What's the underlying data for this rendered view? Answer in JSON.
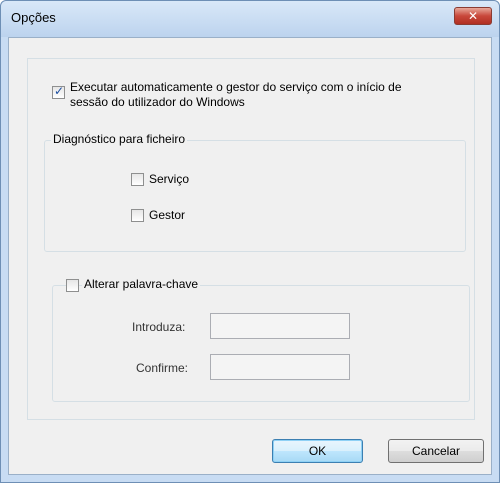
{
  "window": {
    "title": "Opções"
  },
  "options": {
    "auto_start": {
      "label_line1": "Executar automaticamente o gestor do serviço com o início de",
      "label_line2": "sessão do utilizador do Windows",
      "checked": true
    }
  },
  "diagnostics": {
    "legend": "Diagnóstico para ficheiro",
    "service_label": "Serviço",
    "manager_label": "Gestor"
  },
  "password": {
    "legend": "Alterar palavra-chave",
    "enter_label": "Introduza:",
    "confirm_label": "Confirme:"
  },
  "buttons": {
    "ok": "OK",
    "cancel": "Cancelar"
  }
}
